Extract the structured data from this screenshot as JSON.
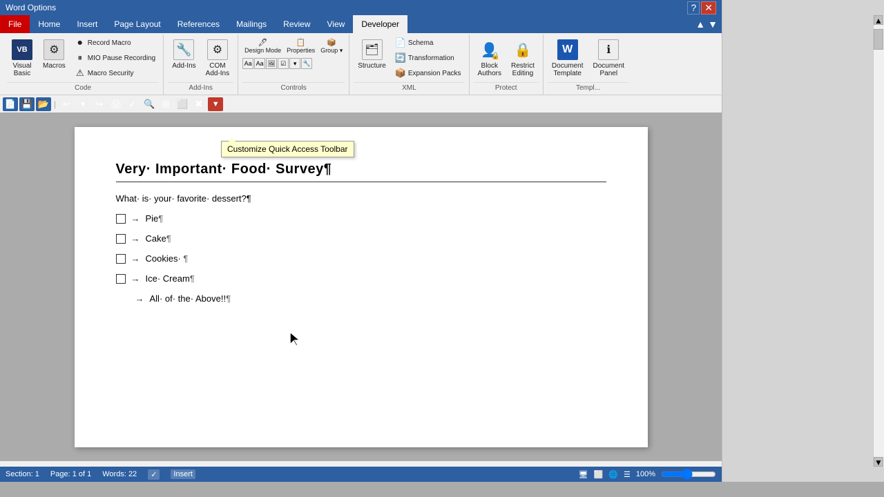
{
  "titlebar": {
    "title": "Word Options",
    "buttons": [
      "minimize",
      "restore",
      "close"
    ]
  },
  "tabs": [
    {
      "label": "File",
      "active": false,
      "type": "file"
    },
    {
      "label": "Home",
      "active": false
    },
    {
      "label": "Insert",
      "active": false
    },
    {
      "label": "Page Layout",
      "active": false
    },
    {
      "label": "References",
      "active": false
    },
    {
      "label": "Mailings",
      "active": false
    },
    {
      "label": "Review",
      "active": false
    },
    {
      "label": "View",
      "active": false
    },
    {
      "label": "Developer",
      "active": true
    }
  ],
  "groups": [
    {
      "name": "Code",
      "buttons": [
        {
          "label": "Visual\nBasic",
          "icon": "🔷"
        },
        {
          "label": "Macros",
          "icon": "⚙"
        }
      ],
      "small_buttons": [
        {
          "label": "Record Macro",
          "icon": "⏺"
        },
        {
          "label": "II● Pause Recording",
          "icon": ""
        },
        {
          "label": "⚠ Macro Security",
          "icon": ""
        }
      ]
    },
    {
      "name": "Add-Ins",
      "buttons": [
        {
          "label": "Add-Ins",
          "icon": "🔌"
        },
        {
          "label": "COM\nAdd-Ins",
          "icon": "⚙"
        }
      ]
    },
    {
      "name": "Controls",
      "buttons": []
    },
    {
      "name": "XML",
      "buttons": [
        {
          "label": "Structure",
          "icon": "🔲"
        }
      ],
      "small_buttons": [
        {
          "label": "Schema",
          "icon": "📋"
        },
        {
          "label": "Transformation",
          "icon": "🔄"
        },
        {
          "label": "Expansion Packs",
          "icon": "📦"
        }
      ]
    },
    {
      "name": "Protect",
      "buttons": [
        {
          "label": "Block\nAuthors",
          "icon": "👤"
        },
        {
          "label": "Restrict\nEditing",
          "icon": "🔒"
        }
      ]
    },
    {
      "name": "Templates",
      "buttons": [
        {
          "label": "Document\nTemplate",
          "icon": "W"
        },
        {
          "label": "Document\nPanel",
          "icon": "ℹ"
        }
      ]
    }
  ],
  "tooltip": "Customize Quick Access Toolbar",
  "document": {
    "title": "Very·Important·Food·Survey¶",
    "question": "What·is·your·favorite·dessert?¶",
    "items": [
      {
        "checkbox": true,
        "text": "Pie¶"
      },
      {
        "checkbox": true,
        "text": "Cake¶"
      },
      {
        "checkbox": true,
        "text": "Cookies·¶"
      },
      {
        "checkbox": true,
        "text": "Ice·Cream¶"
      },
      {
        "checkbox": false,
        "text": "All·of·the·Above!!¶",
        "indent": true
      }
    ]
  },
  "statusbar": {
    "section": "Section: 1",
    "page": "Page: 1 of 1",
    "words": "Words: 22",
    "mode": "Insert",
    "zoom": "100%"
  }
}
